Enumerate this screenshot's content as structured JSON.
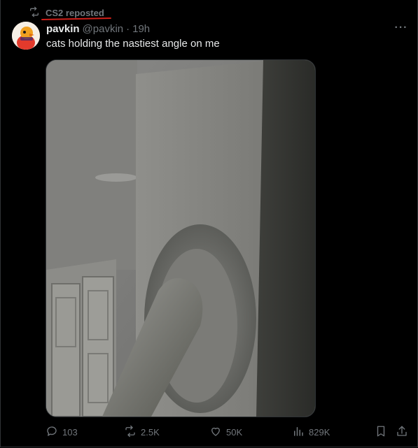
{
  "repost": {
    "text": "CS2 reposted",
    "icon": "repost-icon"
  },
  "tweet": {
    "author_name": "pavkin",
    "handle": "@pavkin",
    "separator": "·",
    "time": "19h",
    "text": "cats holding the nastiest angle on me",
    "more_icon": "more-icon",
    "more_label": "···"
  },
  "media": {
    "kind": "photo"
  },
  "actions": {
    "replies": "103",
    "reposts": "2.5K",
    "likes": "50K",
    "views": "829K"
  },
  "colors": {
    "background": "#000000",
    "text": "#e7e9ea",
    "muted": "#71767b",
    "annotation_underline": "#d0201a"
  }
}
